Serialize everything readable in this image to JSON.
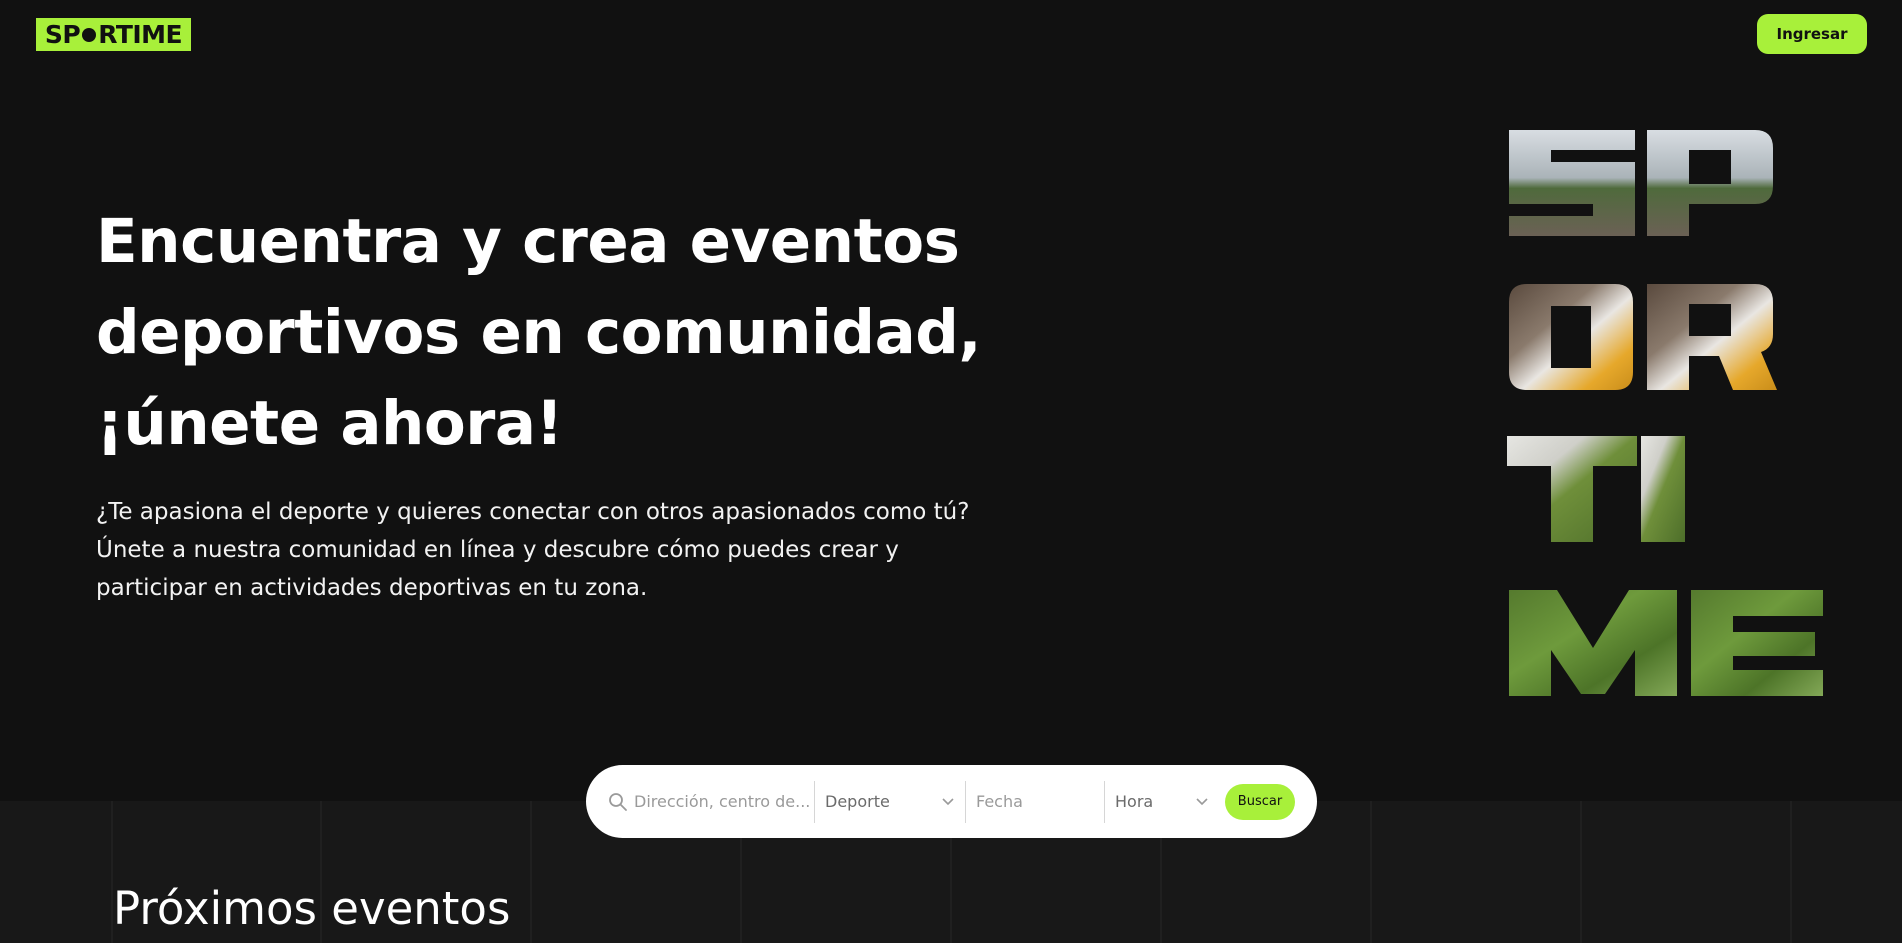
{
  "header": {
    "logo_text_left": "SP",
    "logo_text_right": "RTIME",
    "login_label": "Ingresar"
  },
  "hero": {
    "title_line1": "Encuentra y crea eventos",
    "title_line2": "deportivos en comunidad,",
    "title_line3": "¡únete ahora!",
    "desc_line1": "¿Te apasiona el deporte y quieres conectar con otros apasionados como tú?",
    "desc_line2": "Únete a nuestra comunidad en línea y descubre cómo puedes crear y",
    "desc_line3": "participar en actividades deportivas en tu zona."
  },
  "search": {
    "address_placeholder": "Dirección, centro de...",
    "sport_label": "Deporte",
    "date_placeholder": "Fecha",
    "hour_label": "Hora",
    "search_button": "Buscar"
  },
  "events_section": {
    "title": "Próximos eventos"
  },
  "colors": {
    "accent": "#a8f03a",
    "background": "#111111",
    "section_background": "#181818"
  },
  "icons": {
    "search": "search-icon",
    "chevron": "chevron-down-icon"
  }
}
